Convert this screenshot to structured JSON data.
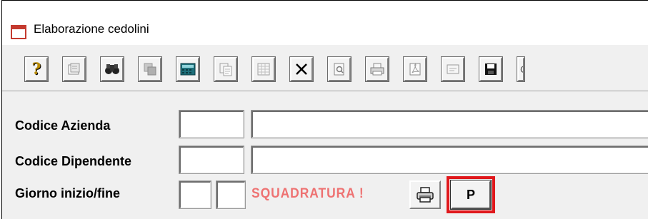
{
  "window": {
    "title": "Elaborazione cedolini"
  },
  "toolbar": {
    "buttons": [
      {
        "name": "help",
        "glyph": "?",
        "color": "#c79a00"
      },
      {
        "name": "properties"
      },
      {
        "name": "find",
        "glyph": "🔭"
      },
      {
        "name": "copy-layers"
      },
      {
        "name": "calculator"
      },
      {
        "name": "paste"
      },
      {
        "name": "grid"
      },
      {
        "name": "delete",
        "glyph": "✕"
      },
      {
        "name": "preview"
      },
      {
        "name": "print"
      },
      {
        "name": "pdf-export"
      },
      {
        "name": "note"
      },
      {
        "name": "save"
      }
    ],
    "partial_button_glyph": "C"
  },
  "form": {
    "codice_azienda_label": "Codice Azienda",
    "codice_azienda_code": "",
    "codice_azienda_desc": "",
    "codice_dipendente_label": "Codice Dipendente",
    "codice_dipendente_code": "",
    "codice_dipendente_desc": "",
    "giorno_label": "Giorno inizio/fine",
    "giorno_inizio": "",
    "giorno_fine": "",
    "warning": "SQUADRATURA !",
    "p_button_label": "P"
  },
  "colors": {
    "warning": "#ee7272",
    "highlight": "#e0181c",
    "app_icon": "#c43a2f"
  }
}
